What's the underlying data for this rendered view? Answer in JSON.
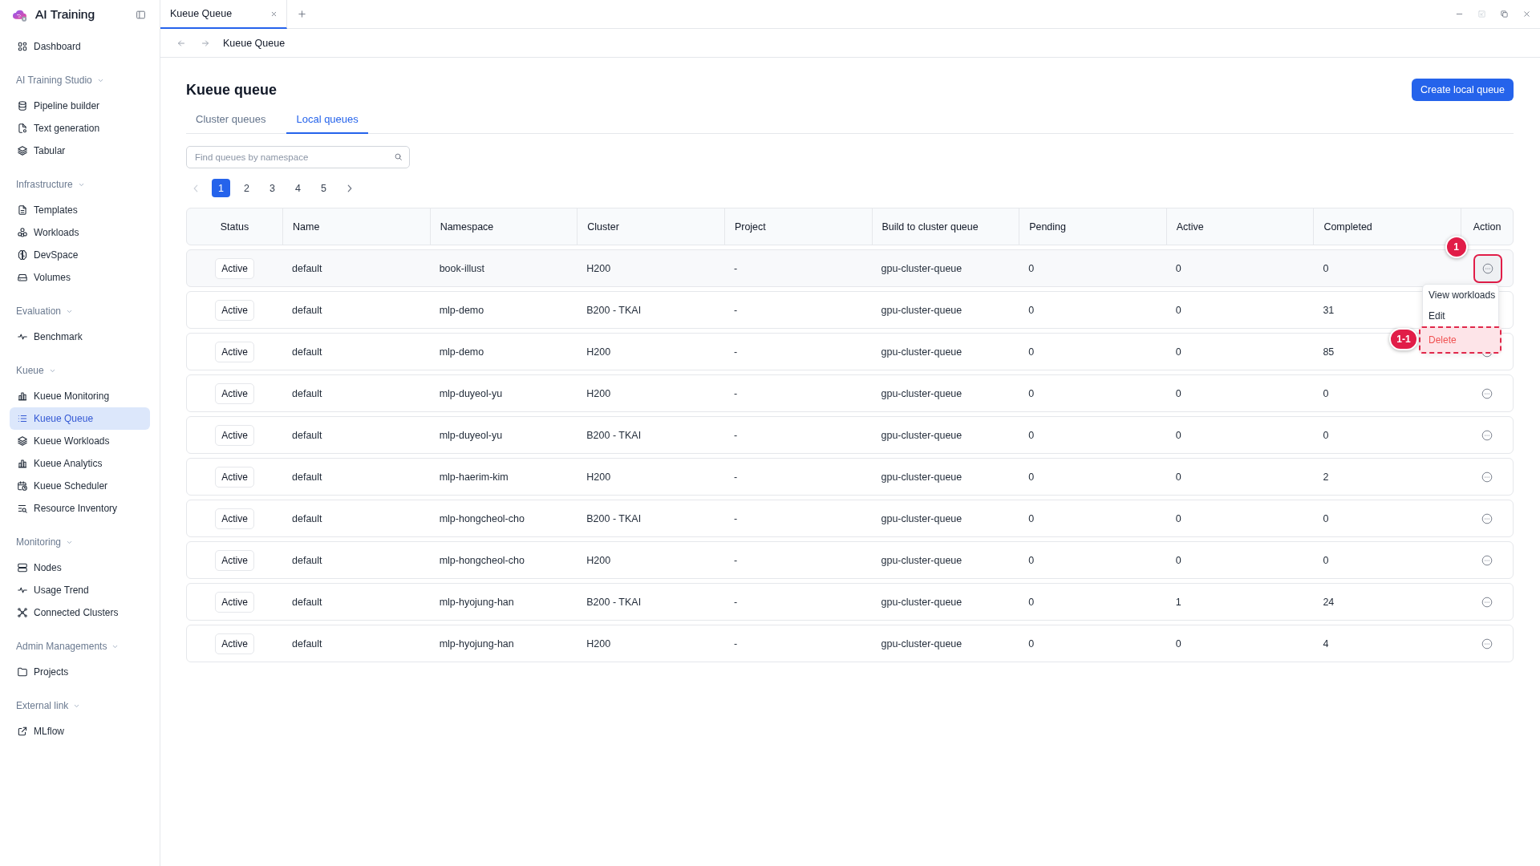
{
  "sidebar": {
    "brand": "AI Training",
    "groups": [
      {
        "items": [
          {
            "label": "Dashboard",
            "selected": false
          }
        ]
      },
      {
        "title": "AI Training Studio",
        "expanded": true,
        "items": [
          {
            "label": "Pipeline builder",
            "selected": false
          },
          {
            "label": "Text generation",
            "selected": false
          },
          {
            "label": "Tabular",
            "selected": false
          }
        ]
      },
      {
        "title": "Infrastructure",
        "expanded": true,
        "items": [
          {
            "label": "Templates",
            "selected": false
          },
          {
            "label": "Workloads",
            "selected": false
          },
          {
            "label": "DevSpace",
            "selected": false
          },
          {
            "label": "Volumes",
            "selected": false
          }
        ]
      },
      {
        "title": "Evaluation",
        "expanded": true,
        "items": [
          {
            "label": "Benchmark",
            "selected": false
          }
        ]
      },
      {
        "title": "Kueue",
        "expanded": true,
        "items": [
          {
            "label": "Kueue Monitoring",
            "selected": false
          },
          {
            "label": "Kueue Queue",
            "selected": true
          },
          {
            "label": "Kueue Workloads",
            "selected": false
          },
          {
            "label": "Kueue Analytics",
            "selected": false
          },
          {
            "label": "Kueue Scheduler",
            "selected": false
          },
          {
            "label": "Resource Inventory",
            "selected": false
          }
        ]
      },
      {
        "title": "Monitoring",
        "expanded": true,
        "items": [
          {
            "label": "Nodes",
            "selected": false
          },
          {
            "label": "Usage Trend",
            "selected": false
          },
          {
            "label": "Connected Clusters",
            "selected": false
          }
        ]
      },
      {
        "title": "Admin Managements",
        "expanded": true,
        "items": [
          {
            "label": "Projects",
            "selected": false
          }
        ]
      },
      {
        "title": "External link",
        "expanded": true,
        "items": [
          {
            "label": "MLflow",
            "selected": false
          }
        ]
      }
    ]
  },
  "window_tabs": [
    {
      "label": "Kueue Queue",
      "selected": true
    }
  ],
  "breadcrumb": {
    "current": "Kueue Queue"
  },
  "page": {
    "title": "Kueue queue",
    "create_button": "Create local queue",
    "tabs": [
      {
        "label": "Cluster queues",
        "selected": false
      },
      {
        "label": "Local queues",
        "selected": true
      }
    ],
    "search": {
      "placeholder": "Find queues by namespace"
    },
    "pagination": {
      "previous_disabled": true,
      "next_disabled": false,
      "pages": [
        {
          "label": "1",
          "selected": true
        },
        {
          "label": "2",
          "selected": false
        },
        {
          "label": "3",
          "selected": false
        },
        {
          "label": "4",
          "selected": false
        },
        {
          "label": "5",
          "selected": false
        }
      ]
    }
  },
  "table": {
    "columns": [
      "Status",
      "Name",
      "Namespace",
      "Cluster",
      "Project",
      "Build to cluster queue",
      "Pending",
      "Active",
      "Completed",
      "Action"
    ],
    "rows": [
      {
        "status": "Active",
        "name": "default",
        "namespace": "book-illust",
        "cluster": "H200",
        "project": "-",
        "cluster_queue": "gpu-cluster-queue",
        "pending": "0",
        "active": "0",
        "completed": "0",
        "highlighted": true,
        "annotation": "1",
        "menu": [
          {
            "label": "View workloads",
            "kind": "normal",
            "highlighted": false
          },
          {
            "label": "Edit",
            "kind": "normal",
            "highlighted": false
          },
          {
            "label": "Delete",
            "kind": "danger",
            "highlighted": true,
            "annotation": "1-1"
          }
        ]
      },
      {
        "status": "Active",
        "name": "default",
        "namespace": "mlp-demo",
        "cluster": "B200 - TKAI",
        "project": "-",
        "cluster_queue": "gpu-cluster-queue",
        "pending": "0",
        "active": "0",
        "completed": "31",
        "highlighted": false
      },
      {
        "status": "Active",
        "name": "default",
        "namespace": "mlp-demo",
        "cluster": "H200",
        "project": "-",
        "cluster_queue": "gpu-cluster-queue",
        "pending": "0",
        "active": "0",
        "completed": "85",
        "highlighted": false
      },
      {
        "status": "Active",
        "name": "default",
        "namespace": "mlp-duyeol-yu",
        "cluster": "H200",
        "project": "-",
        "cluster_queue": "gpu-cluster-queue",
        "pending": "0",
        "active": "0",
        "completed": "0",
        "highlighted": false
      },
      {
        "status": "Active",
        "name": "default",
        "namespace": "mlp-duyeol-yu",
        "cluster": "B200 - TKAI",
        "project": "-",
        "cluster_queue": "gpu-cluster-queue",
        "pending": "0",
        "active": "0",
        "completed": "0",
        "highlighted": false
      },
      {
        "status": "Active",
        "name": "default",
        "namespace": "mlp-haerim-kim",
        "cluster": "H200",
        "project": "-",
        "cluster_queue": "gpu-cluster-queue",
        "pending": "0",
        "active": "0",
        "completed": "2",
        "highlighted": false
      },
      {
        "status": "Active",
        "name": "default",
        "namespace": "mlp-hongcheol-cho",
        "cluster": "B200 - TKAI",
        "project": "-",
        "cluster_queue": "gpu-cluster-queue",
        "pending": "0",
        "active": "0",
        "completed": "0",
        "highlighted": false
      },
      {
        "status": "Active",
        "name": "default",
        "namespace": "mlp-hongcheol-cho",
        "cluster": "H200",
        "project": "-",
        "cluster_queue": "gpu-cluster-queue",
        "pending": "0",
        "active": "0",
        "completed": "0",
        "highlighted": false
      },
      {
        "status": "Active",
        "name": "default",
        "namespace": "mlp-hyojung-han",
        "cluster": "B200 - TKAI",
        "project": "-",
        "cluster_queue": "gpu-cluster-queue",
        "pending": "0",
        "active": "1",
        "completed": "24",
        "highlighted": false
      },
      {
        "status": "Active",
        "name": "default",
        "namespace": "mlp-hyojung-han",
        "cluster": "H200",
        "project": "-",
        "cluster_queue": "gpu-cluster-queue",
        "pending": "0",
        "active": "0",
        "completed": "4",
        "highlighted": false
      }
    ]
  }
}
